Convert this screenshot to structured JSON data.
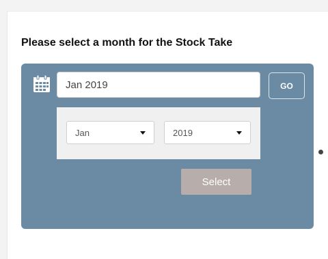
{
  "heading": "Please select a month for the Stock Take",
  "date_input": {
    "value": "Jan 2019"
  },
  "go_button": {
    "label": "GO"
  },
  "month_select": {
    "value": "Jan"
  },
  "year_select": {
    "value": "2019"
  },
  "select_button": {
    "label": "Select"
  },
  "icons": {
    "calendar": "calendar-icon",
    "dropdown": "caret-down-icon"
  },
  "colors": {
    "panel": "#6b8aa3",
    "select_button": "#b7aeab",
    "picker_background": "#f0f0f0"
  }
}
